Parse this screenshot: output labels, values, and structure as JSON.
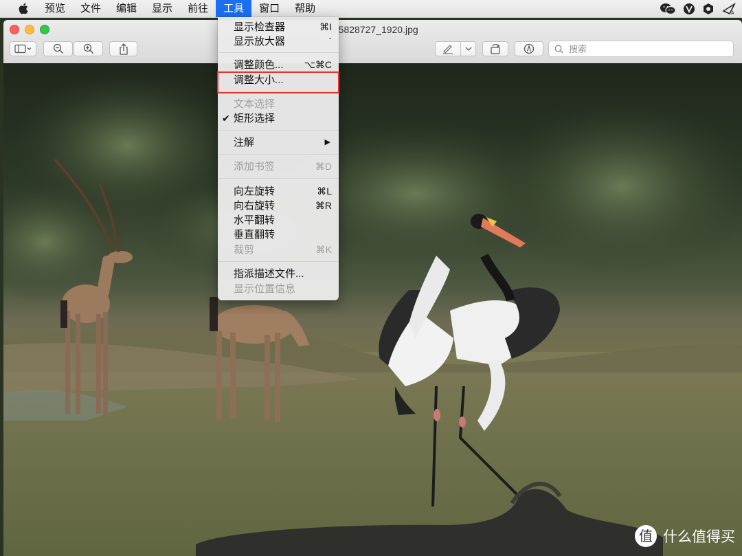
{
  "menubar": {
    "items": [
      "预览",
      "文件",
      "编辑",
      "显示",
      "前往",
      "工具",
      "窗口",
      "帮助"
    ],
    "active": "工具"
  },
  "window": {
    "title": "rk-5828727_1920.jpg",
    "search_placeholder": "搜索"
  },
  "tools_menu": {
    "items": [
      {
        "label": "显示检查器",
        "shortcut": "⌘I"
      },
      {
        "label": "显示放大器",
        "shortcut": "`"
      },
      {
        "label": "调整颜色...",
        "shortcut": "⌥⌘C"
      },
      {
        "label": "调整大小...",
        "shortcut": ""
      },
      {
        "label": "文本选择",
        "shortcut": ""
      },
      {
        "label": "矩形选择",
        "shortcut": ""
      },
      {
        "label": "注解",
        "shortcut": "▶"
      },
      {
        "label": "添加书签",
        "shortcut": "⌘D"
      },
      {
        "label": "向左旋转",
        "shortcut": "⌘L"
      },
      {
        "label": "向右旋转",
        "shortcut": "⌘R"
      },
      {
        "label": "水平翻转",
        "shortcut": ""
      },
      {
        "label": "垂直翻转",
        "shortcut": ""
      },
      {
        "label": "裁剪",
        "shortcut": "⌘K"
      },
      {
        "label": "指派描述文件...",
        "shortcut": ""
      },
      {
        "label": "显示位置信息",
        "shortcut": ""
      }
    ],
    "checked_item": "矩形选择",
    "disabled_items": [
      "文本选择",
      "添加书签",
      "裁剪",
      "显示位置信息"
    ],
    "highlighted_item": "调整大小..."
  },
  "watermark": {
    "text": "什么值得买"
  },
  "colors": {
    "menu_active": "#1a6ff0",
    "highlight_border": "#e5352c"
  }
}
